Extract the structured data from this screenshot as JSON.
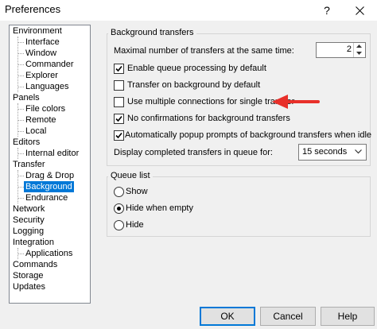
{
  "window": {
    "title": "Preferences",
    "help_glyph": "?",
    "close_icon": "close-icon"
  },
  "tree": {
    "items": [
      {
        "label": "Environment",
        "level": 0
      },
      {
        "label": "Interface",
        "level": 1
      },
      {
        "label": "Window",
        "level": 1
      },
      {
        "label": "Commander",
        "level": 1
      },
      {
        "label": "Explorer",
        "level": 1
      },
      {
        "label": "Languages",
        "level": 1
      },
      {
        "label": "Panels",
        "level": 0
      },
      {
        "label": "File colors",
        "level": 1
      },
      {
        "label": "Remote",
        "level": 1
      },
      {
        "label": "Local",
        "level": 1
      },
      {
        "label": "Editors",
        "level": 0
      },
      {
        "label": "Internal editor",
        "level": 1
      },
      {
        "label": "Transfer",
        "level": 0
      },
      {
        "label": "Drag & Drop",
        "level": 1
      },
      {
        "label": "Background",
        "level": 1,
        "selected": true
      },
      {
        "label": "Endurance",
        "level": 1
      },
      {
        "label": "Network",
        "level": 0
      },
      {
        "label": "Security",
        "level": 0
      },
      {
        "label": "Logging",
        "level": 0
      },
      {
        "label": "Integration",
        "level": 0
      },
      {
        "label": "Applications",
        "level": 1
      },
      {
        "label": "Commands",
        "level": 0
      },
      {
        "label": "Storage",
        "level": 0
      },
      {
        "label": "Updates",
        "level": 0
      }
    ]
  },
  "background_transfers": {
    "title": "Background transfers",
    "max_transfers_label": "Maximal number of transfers at the same time:",
    "max_transfers_value": "2",
    "enable_queue_label": "Enable queue processing by default",
    "enable_queue_checked": true,
    "transfer_background_label": "Transfer on background by default",
    "transfer_background_checked": false,
    "multiple_connections_label": "Use multiple connections for single transfer",
    "multiple_connections_checked": false,
    "no_confirmations_label": "No confirmations for background transfers",
    "no_confirmations_checked": true,
    "auto_popup_label": "Automatically popup prompts of background transfers when idle",
    "auto_popup_checked": true,
    "display_completed_label": "Display completed transfers in queue for:",
    "display_completed_value": "15 seconds"
  },
  "queue_list": {
    "title": "Queue list",
    "options": [
      "Show",
      "Hide when empty",
      "Hide"
    ],
    "selected": "Hide when empty"
  },
  "buttons": {
    "ok": "OK",
    "cancel": "Cancel",
    "help": "Help"
  },
  "annotation": {
    "arrow_color": "#e8302a"
  },
  "colors": {
    "selection": "#0078d7"
  }
}
